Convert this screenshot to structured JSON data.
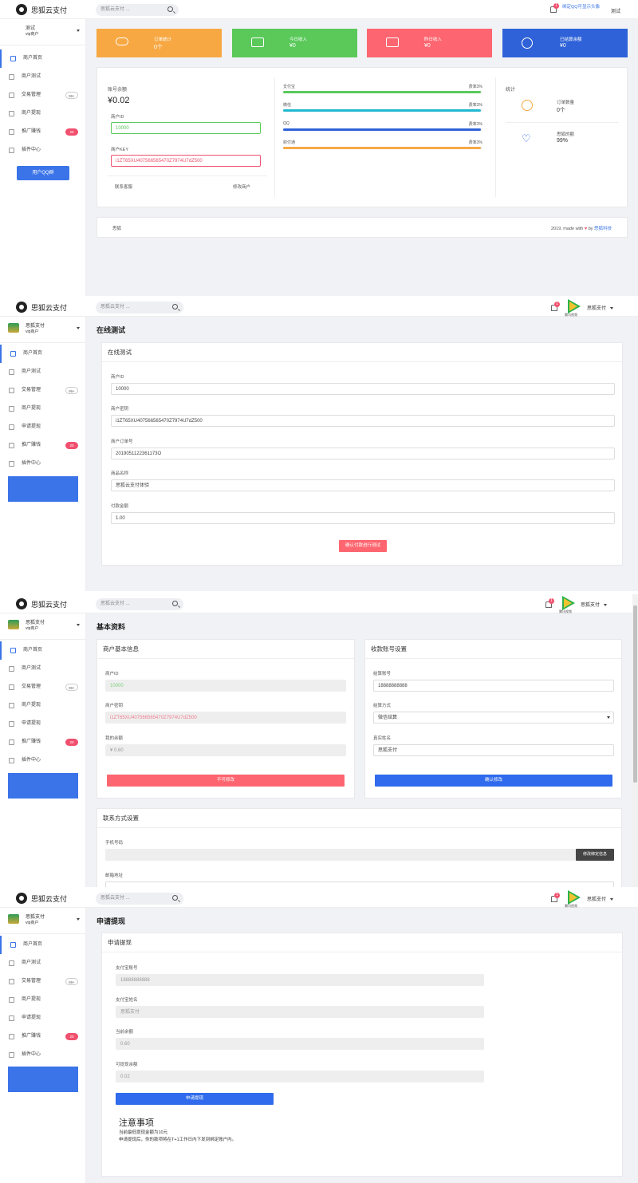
{
  "brand": "思狐云支付",
  "search_placeholder": "思狐云支付 ...",
  "bell_count": "1",
  "user_display": "思狐支付",
  "avatar_caption": "腾讯视频",
  "sidebar": {
    "user_name": "思狐支付",
    "user_name_s1": "测试",
    "user_level": "vip商户",
    "items": [
      {
        "label": "商户首页"
      },
      {
        "label": "商户测试"
      },
      {
        "label": "交易管理",
        "badge": "99+"
      },
      {
        "label": "商户提现"
      },
      {
        "label": "申请提现"
      },
      {
        "label": "推广赚钱",
        "badge": "20"
      },
      {
        "label": "插件中心"
      }
    ],
    "qq_group_button": "用户QQ群",
    "blue_block_label": "用户QQ群"
  },
  "s1": {
    "topbar_hint": "绑定QQ可显示头像",
    "topbar_user": "测试",
    "tiles": [
      {
        "label": "订单统计",
        "value": "0个",
        "color": "#f7a843"
      },
      {
        "label": "今日收入",
        "value": "¥0",
        "color": "#5ac95a"
      },
      {
        "label": "昨日收入",
        "value": "¥0",
        "color": "#fd6670"
      },
      {
        "label": "已结算余额",
        "value": "¥0",
        "color": "#2f62d8"
      }
    ],
    "balance_label": "账号余额",
    "balance_value": "¥0.02",
    "merchant_id_label": "商户ID",
    "merchant_id_value": "10000",
    "pkey_label": "商户KEY",
    "pkey_value": "i1ZT65XU407566565470Z7974U7dZ500",
    "contact_link": "联系客服",
    "edit_link": "修改商户",
    "channels": [
      {
        "name": "支付宝",
        "rate": "费率3%",
        "color": "#5ac95a",
        "fill": 0.99
      },
      {
        "name": "微信",
        "rate": "费率3%",
        "color": "#22b8cf",
        "fill": 0.99
      },
      {
        "name": "QQ",
        "rate": "费率3%",
        "color": "#2f62d8",
        "fill": 0.99
      },
      {
        "name": "财付通",
        "rate": "费率3%",
        "color": "#f7a843",
        "fill": 0.99
      }
    ],
    "stats_title": "统计",
    "stat_orders_label": "订单数量",
    "stat_orders_value": "0个",
    "stat_rate_label": "思狐的额",
    "stat_rate_value": "99%",
    "footer_left": "思狐",
    "footer_right_prefix": "2019, made with",
    "footer_right_by": "by",
    "footer_right_link": "思狐科技"
  },
  "s2": {
    "page_title": "在线测试",
    "card_title": "在线测试",
    "fields": [
      {
        "label": "商户ID",
        "value": "10000"
      },
      {
        "label": "商户密钥",
        "value": "i1ZT65XU407566565470Z7974U7dZ500"
      },
      {
        "label": "商户订单号",
        "value": "2019051122361173O"
      },
      {
        "label": "商品名称",
        "value": "思狐云支付体验"
      },
      {
        "label": "付款金额",
        "value": "1.00"
      }
    ],
    "submit": "确认付款进行测试"
  },
  "s3": {
    "page_title": "基本资料",
    "basic_title": "商户基本信息",
    "basic_fields": [
      {
        "label": "商户ID",
        "value": "10000"
      },
      {
        "label": "商户密钥",
        "value": "i1ZT65XU407566565470Z7974U7dZ500"
      },
      {
        "label": "我的余额",
        "value": "¥ 0.60"
      }
    ],
    "basic_button": "不可修改",
    "settle_title": "收款账号设置",
    "settle_fields": [
      {
        "label": "结算账号",
        "value": "18888888888"
      },
      {
        "label": "结算方式",
        "value": "微信结算"
      },
      {
        "label": "真实姓名",
        "value": "思狐支付"
      }
    ],
    "settle_button": "确认修改",
    "contact_title": "联系方式设置",
    "phone_label": "手机号码",
    "phone_button": "修改绑定信息",
    "email_label": "邮箱地址"
  },
  "s4": {
    "page_title": "申请提现",
    "card_title": "申请提现",
    "fields": [
      {
        "label": "支付宝账号",
        "value": "18888888888"
      },
      {
        "label": "支付宝姓名",
        "value": "思狐支付"
      },
      {
        "label": "当前余额",
        "value": "0.60"
      },
      {
        "label": "可提现余额",
        "value": "0.02"
      }
    ],
    "submit": "申请提现",
    "notice_title": "注意事项",
    "notice_1": "当前最低提现金额为10元",
    "notice_2": "申请提现后，你的款项将在T+1工作日内下发到绑定账户内。"
  }
}
